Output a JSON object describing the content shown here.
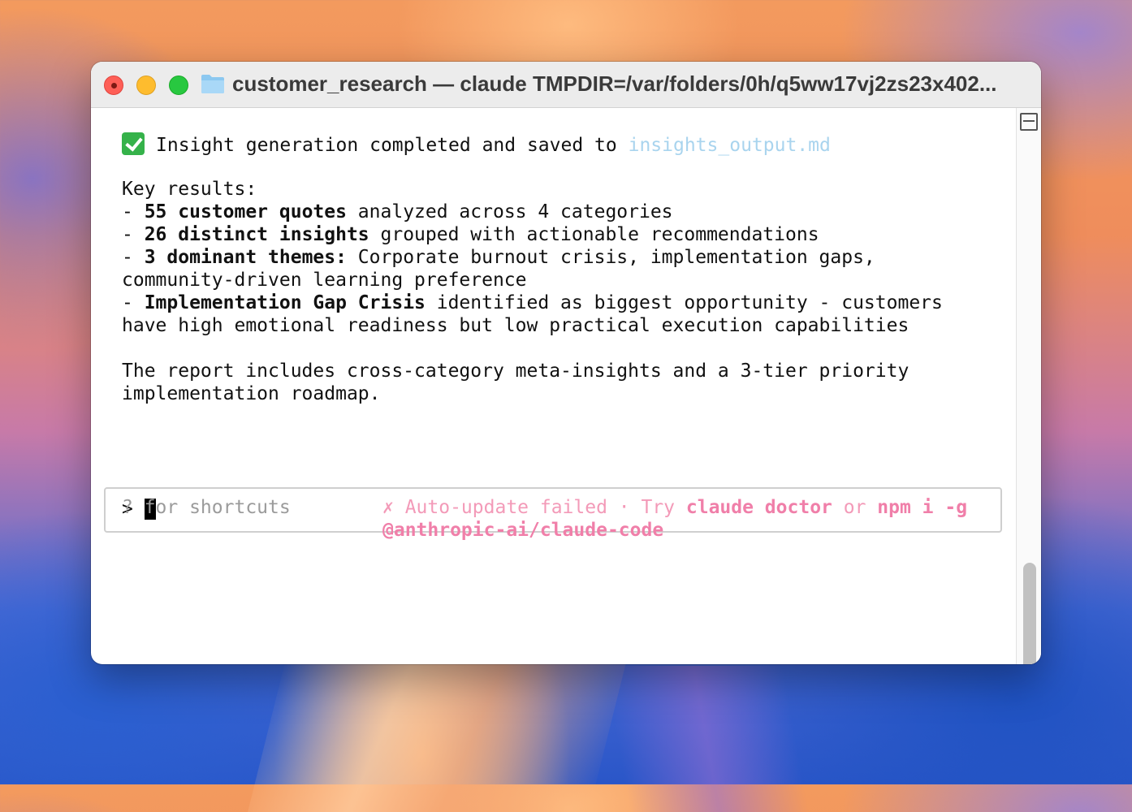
{
  "window": {
    "title": "customer_research — claude TMPDIR=/var/folders/0h/q5ww17vj2zs23x402..."
  },
  "output": {
    "status_check_icon": "check-mark-icon",
    "status_text": "Insight generation completed and saved to ",
    "status_link": "insights_output.md",
    "key_results_label": "Key results:",
    "item1_prefix": "- ",
    "item1_bold": "55 customer quotes",
    "item1_rest": " analyzed across 4 categories",
    "item2_prefix": "- ",
    "item2_bold": "26 distinct insights",
    "item2_rest": " grouped with actionable recommendations",
    "item3_prefix": "- ",
    "item3_bold": "3 dominant themes:",
    "item3_rest": " Corporate burnout crisis, implementation gaps,",
    "item3_cont": "community-driven learning preference",
    "item4_prefix": "- ",
    "item4_bold": "Implementation Gap Crisis",
    "item4_rest": " identified as biggest opportunity - customers",
    "item4_cont": "have high emotional readiness but low practical execution capabilities",
    "report_line1": "The report includes cross-category meta-insights and a 3-tier priority",
    "report_line2": "implementation roadmap."
  },
  "input": {
    "prompt": ">",
    "value": ""
  },
  "footer": {
    "shortcuts_hint": "? for shortcuts",
    "warn_text1": "✗ Auto-update failed · Try ",
    "warn_cmd1": "claude doctor",
    "warn_or": " or ",
    "warn_cmd2": "npm i -g",
    "warn_cmd2_cont": "@anthropic-ai/claude-code"
  },
  "colors": {
    "link": "#a9d4ee",
    "warning": "#f39ab8",
    "close": "#fe5f57",
    "minimize": "#febc2e",
    "maximize": "#28c840"
  }
}
